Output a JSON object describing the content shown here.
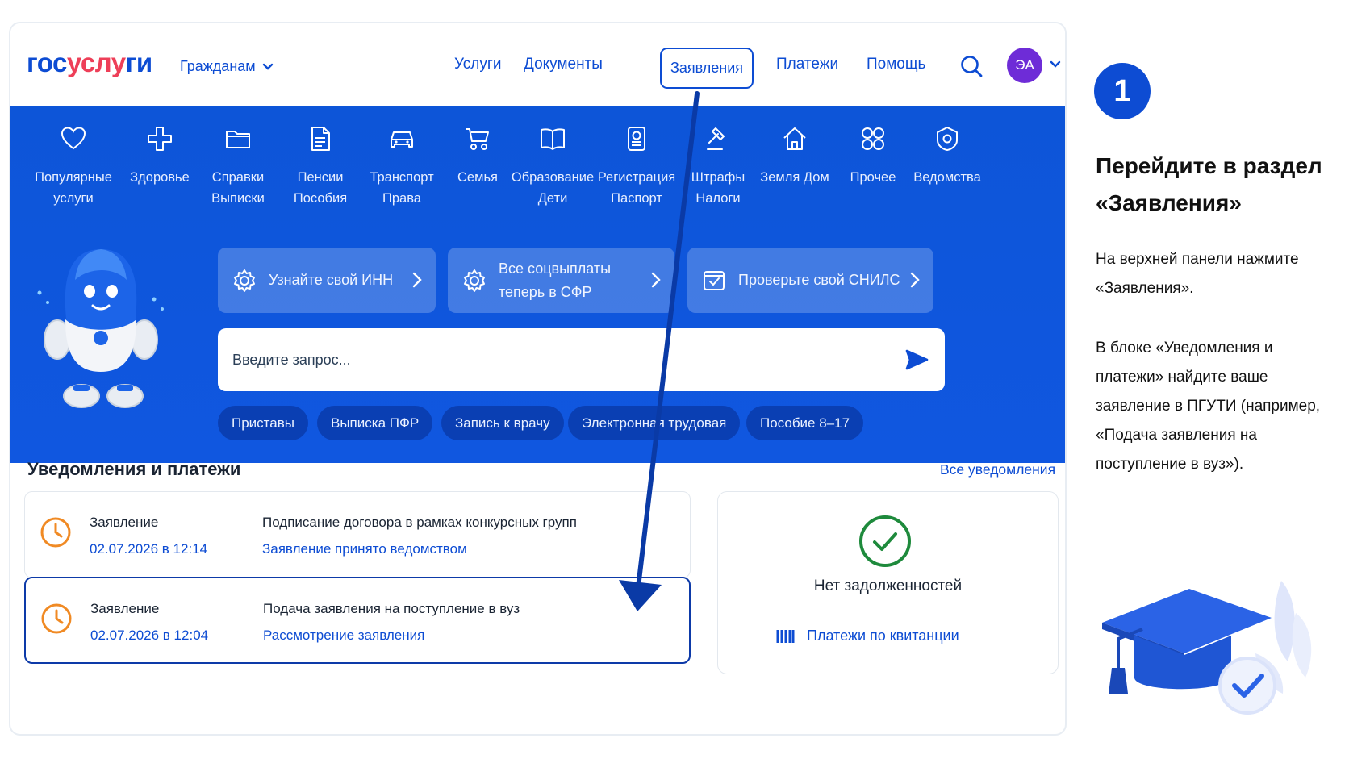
{
  "header": {
    "logo": {
      "gos": "гос",
      "usl": "услу",
      "gi": "ги"
    },
    "citizens_label": "Гражданам",
    "nav": [
      {
        "label": "Услуги"
      },
      {
        "label": "Документы"
      },
      {
        "label": "Заявления",
        "active": true
      },
      {
        "label": "Платежи"
      },
      {
        "label": "Помощь"
      }
    ],
    "avatar_initials": "ЭА"
  },
  "categories": [
    {
      "line1": "Популярные",
      "line2": "услуги",
      "icon": "heart-icon"
    },
    {
      "line1": "Здоровье",
      "line2": "",
      "icon": "plus-icon"
    },
    {
      "line1": "Справки",
      "line2": "Выписки",
      "icon": "folder-icon"
    },
    {
      "line1": "Пенсии",
      "line2": "Пособия",
      "icon": "document-icon"
    },
    {
      "line1": "Транспорт",
      "line2": "Права",
      "icon": "car-icon"
    },
    {
      "line1": "Семья",
      "line2": "",
      "icon": "stroller-icon"
    },
    {
      "line1": "Образование",
      "line2": "Дети",
      "icon": "book-icon"
    },
    {
      "line1": "Регистрация",
      "line2": "Паспорт",
      "icon": "passport-icon"
    },
    {
      "line1": "Штрафы",
      "line2": "Налоги",
      "icon": "gavel-icon"
    },
    {
      "line1": "Земля Дом",
      "line2": "",
      "icon": "house-icon"
    },
    {
      "line1": "Прочее",
      "line2": "",
      "icon": "grid-icon"
    },
    {
      "line1": "Ведомства",
      "line2": "",
      "icon": "emblem-icon"
    }
  ],
  "tiles": [
    {
      "line1": "Узнайте свой ИНН",
      "line2": ""
    },
    {
      "line1": "Все соцвыплаты",
      "line2": "теперь в СФР"
    },
    {
      "line1": "Проверьте свой СНИЛС",
      "line2": ""
    }
  ],
  "search": {
    "placeholder": "Введите запрос..."
  },
  "chips": [
    "Приставы",
    "Выписка ПФР",
    "Запись к врачу",
    "Электронная трудовая",
    "Пособие 8–17"
  ],
  "notifications": {
    "title": "Уведомления и платежи",
    "all_link": "Все уведомления",
    "items": [
      {
        "kind": "Заявление",
        "date": "02.07.2026 в 12:14",
        "subject": "Подписание договора в рамках конкурсных групп",
        "status": "Заявление принято ведомством"
      },
      {
        "kind": "Заявление",
        "date": "02.07.2026 в 12:04",
        "subject": "Подача заявления на поступление в вуз",
        "status": "Рассмотрение заявления"
      }
    ],
    "debt": {
      "text": "Нет задолженностей",
      "link": "Платежи по квитанции"
    }
  },
  "instructions": {
    "step": "1",
    "title": "Перейдите в раздел «Заявления»",
    "p1": "На верхней панели нажмите «Заявления».",
    "p2": "В блоке «Уведомления и платежи» найдите ваше заявление в ПГУТИ (например, «Подача заявления на поступление в вуз»)."
  },
  "colors": {
    "brand_blue": "#0d4cd3",
    "band_blue": "#0d55d8",
    "logo_red": "#ee3f58",
    "avatar": "#6e2cd7",
    "success": "#1e8a3c",
    "clock": "#f08a24"
  }
}
